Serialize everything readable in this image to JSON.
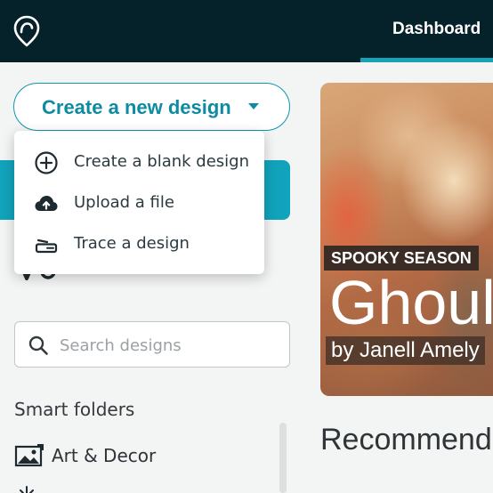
{
  "header": {
    "logo_icon": "pin-logo-icon",
    "nav_tab_label": "Dashboard",
    "brand_color": "#05222a",
    "accent_color": "#17a2b8"
  },
  "sidebar": {
    "create_button_label": "Create a new design",
    "create_menu": [
      {
        "icon": "plus-circle-icon",
        "label": "Create a blank design"
      },
      {
        "icon": "cloud-upload-icon",
        "label": "Upload a file"
      },
      {
        "icon": "trace-icon",
        "label": "Trace a design"
      }
    ],
    "search_placeholder": "Search designs",
    "smart_folders_title": "Smart folders",
    "smart_folders": [
      {
        "icon": "image-icon",
        "label": "Art & Decor"
      }
    ]
  },
  "main": {
    "hero": {
      "tag": "SPOOKY SEASON",
      "title": "Ghoul",
      "author": "by Janell Amely"
    },
    "recommended_title": "Recommende"
  }
}
